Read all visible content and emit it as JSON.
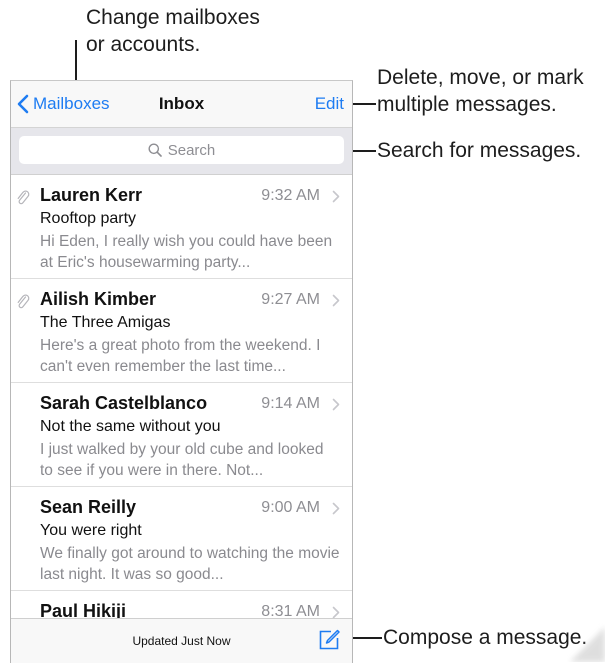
{
  "callouts": {
    "mailboxes_line1": "Change mailboxes",
    "mailboxes_line2": "or accounts.",
    "edit_line1": "Delete, move, or mark",
    "edit_line2": "multiple messages.",
    "search": "Search for messages.",
    "compose": "Compose a message."
  },
  "nav": {
    "back_label": "Mailboxes",
    "title": "Inbox",
    "edit_label": "Edit"
  },
  "search": {
    "placeholder": "Search"
  },
  "messages": [
    {
      "sender": "Lauren Kerr",
      "time": "9:32 AM",
      "subject": "Rooftop party",
      "preview": "Hi Eden, I really wish you could have been at Eric's housewarming party...",
      "attachment": true
    },
    {
      "sender": "Ailish Kimber",
      "time": "9:27 AM",
      "subject": "The Three Amigas",
      "preview": "Here's a great photo from the weekend. I can't even remember the last time...",
      "attachment": true
    },
    {
      "sender": "Sarah Castelblanco",
      "time": "9:14 AM",
      "subject": "Not the same without you",
      "preview": "I just walked by your old cube and looked to see if you were in there. Not...",
      "attachment": false
    },
    {
      "sender": "Sean Reilly",
      "time": "9:00 AM",
      "subject": "You were right",
      "preview": "We finally got around to watching the movie last night. It was so good...",
      "attachment": false
    },
    {
      "sender": "Paul Hikiji",
      "time": "8:31 AM",
      "subject": "",
      "preview": "",
      "attachment": false
    }
  ],
  "toolbar": {
    "status": "Updated Just Now"
  },
  "colors": {
    "accent": "#1e7cf2",
    "secondary_text": "#8e8e93"
  },
  "icons": {
    "back": "chevron-left-icon",
    "search": "search-icon",
    "attachment": "paperclip-icon",
    "disclosure": "chevron-right-icon",
    "compose": "compose-icon"
  }
}
